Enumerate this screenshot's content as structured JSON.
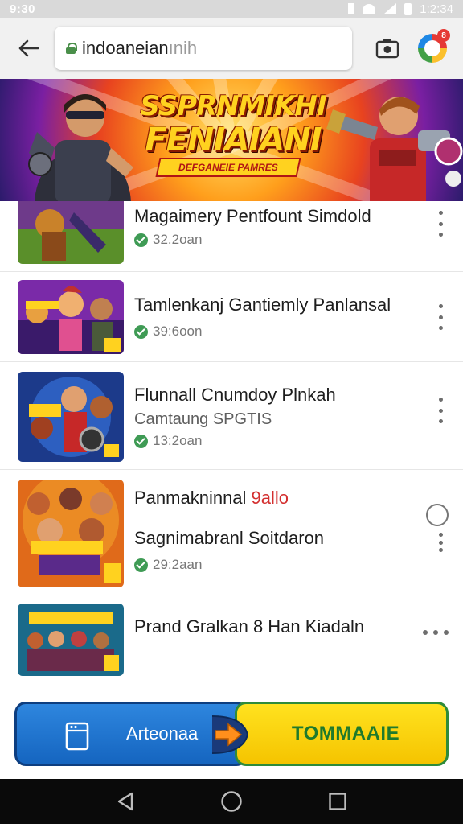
{
  "status_bar": {
    "left_text": "9:30",
    "time": "1:2:34"
  },
  "browser": {
    "url_main": "indoaneian",
    "url_dim": "ınih",
    "profile_badge": "8"
  },
  "banner": {
    "title_line1": "SSPRNMIKHI",
    "title_line2": "FENIAIANI",
    "ribbon_text": "DEFGANEIE PAMRES"
  },
  "list_items": [
    {
      "title": "Magaimery Pentfount Simdold",
      "meta": "32.2oan"
    },
    {
      "title": "Tamlenkanj Gantiemly Panlansal",
      "meta": "39:6oon"
    },
    {
      "title": "Flunnall Cnumdoy Plnkah",
      "subtitle": "Camtaung SPGTIS",
      "meta": "13:2oan"
    },
    {
      "title_prefix": "Panmakninnal ",
      "title_highlight": "9allo",
      "subtitle": "Sagnimabranl Soitdaron",
      "meta": "29:2aan"
    },
    {
      "title": "Prand Gralkan 8 Han Kiadaln"
    }
  ],
  "actions": {
    "primary_label": "Arteonaa",
    "secondary_label": "TOMMAAIE"
  },
  "colors": {
    "accent_blue": "#1565c0",
    "accent_yellow": "#f5c400",
    "accent_green": "#2e8b3a",
    "verified_green": "#3f9b55"
  }
}
